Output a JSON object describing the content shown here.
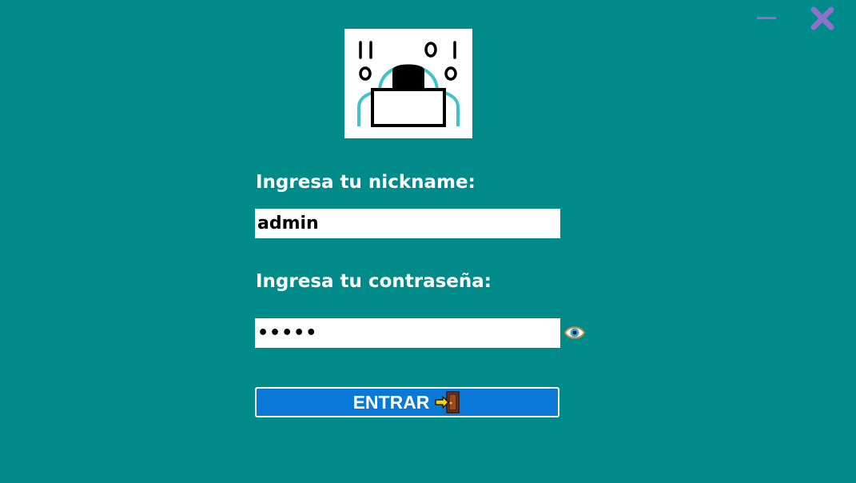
{
  "window": {
    "minimize_icon": "minimize-icon",
    "close_icon": "close-icon",
    "accent_color": "#8e72c9",
    "background_color": "#008b8b"
  },
  "logo": {
    "icon": "hacker-with-laptop-icon",
    "binary_text": "1100101"
  },
  "form": {
    "nickname_label": "Ingresa tu nickname:",
    "nickname_value": "admin",
    "password_label": "Ingresa tu contraseña:",
    "password_value": "admin",
    "show_password_icon": "eye-icon",
    "submit_label": "ENTRAR",
    "submit_icon": "door-enter-icon",
    "submit_color": "#0a78d7"
  }
}
